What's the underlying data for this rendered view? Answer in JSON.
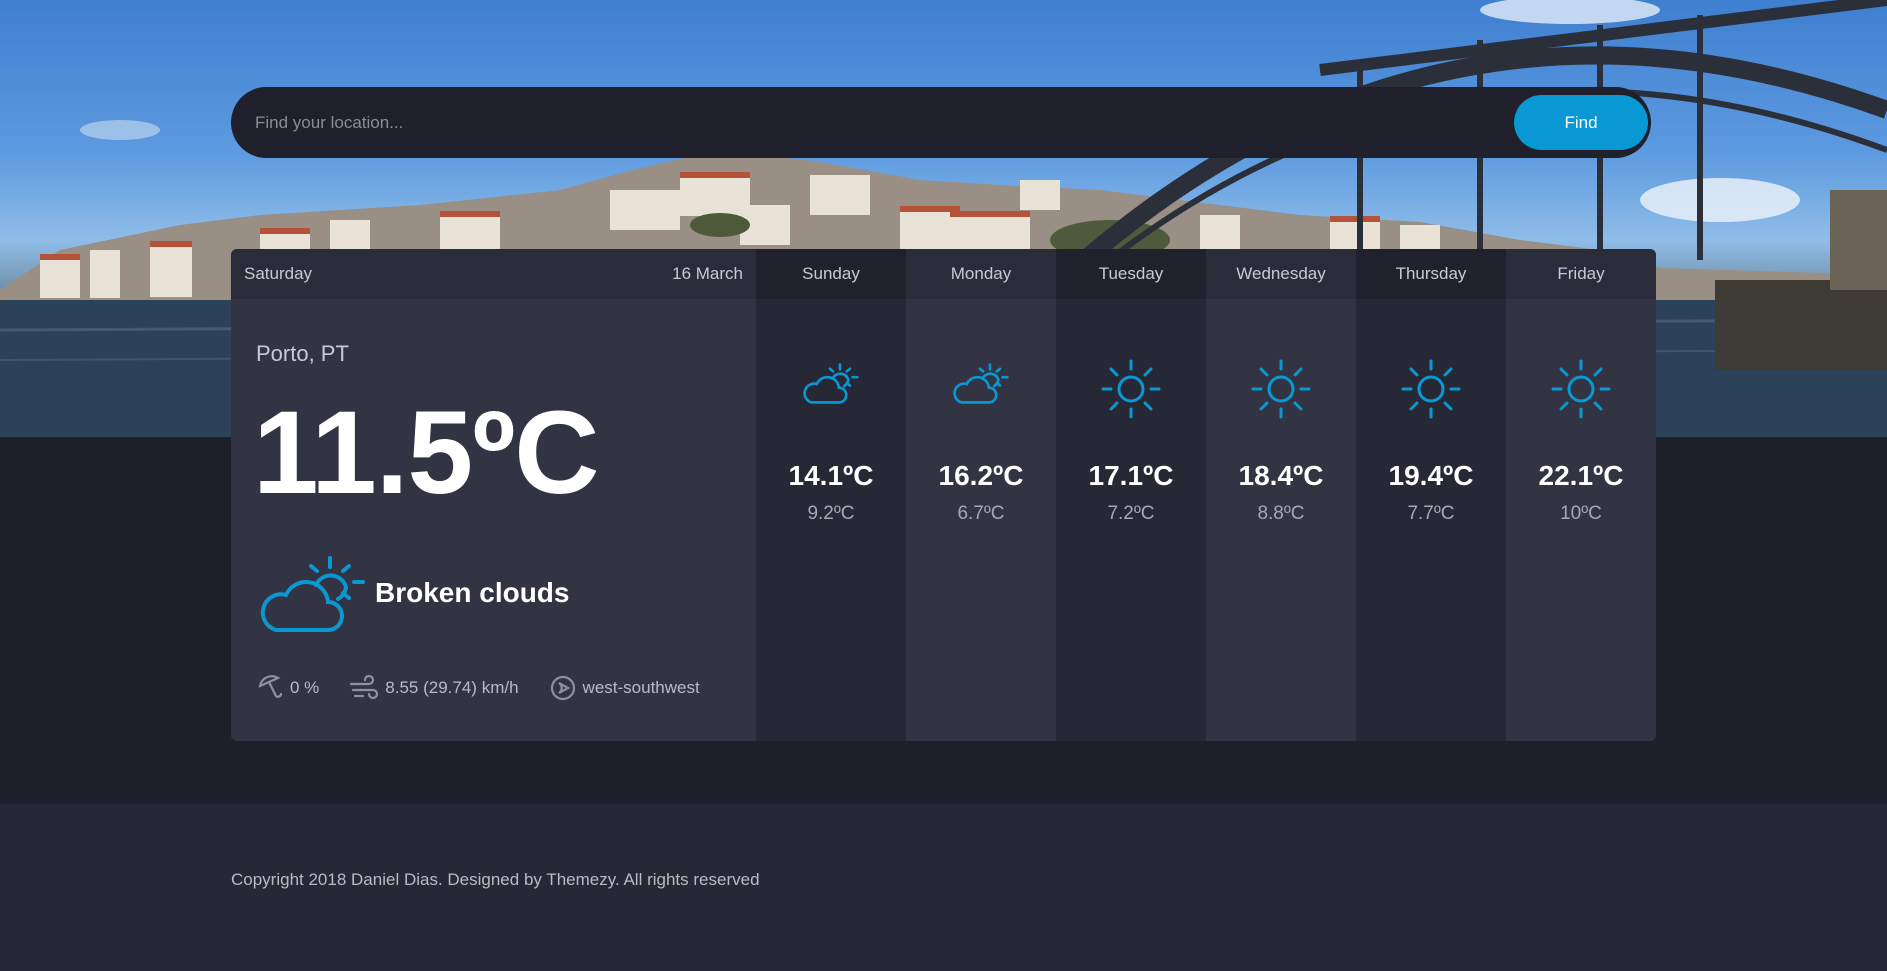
{
  "search": {
    "placeholder": "Find your location...",
    "button_label": "Find"
  },
  "today": {
    "day": "Saturday",
    "date": "16 March",
    "location": "Porto, PT",
    "temperature": "11.5ºC",
    "condition": "Broken clouds",
    "condition_icon": "cloud-sun-icon",
    "precipitation": "0 %",
    "wind_speed": "8.55 (29.74) km/h",
    "wind_direction": "west-southwest"
  },
  "forecast": [
    {
      "day": "Sunday",
      "icon": "cloud-sun-icon",
      "high": "14.1ºC",
      "low": "9.2ºC"
    },
    {
      "day": "Monday",
      "icon": "cloud-sun-icon",
      "high": "16.2ºC",
      "low": "6.7ºC"
    },
    {
      "day": "Tuesday",
      "icon": "sun-icon",
      "high": "17.1ºC",
      "low": "7.2ºC"
    },
    {
      "day": "Wednesday",
      "icon": "sun-icon",
      "high": "18.4ºC",
      "low": "8.8ºC"
    },
    {
      "day": "Thursday",
      "icon": "sun-icon",
      "high": "19.4ºC",
      "low": "7.7ºC"
    },
    {
      "day": "Friday",
      "icon": "sun-icon",
      "high": "22.1ºC",
      "low": "10ºC"
    }
  ],
  "footer": {
    "copyright": "Copyright 2018 Daniel Dias. Designed by Themezy. All rights reserved"
  },
  "colors": {
    "accent": "#0a98d4",
    "background": "#1e1f2b",
    "panel": "#323443"
  }
}
